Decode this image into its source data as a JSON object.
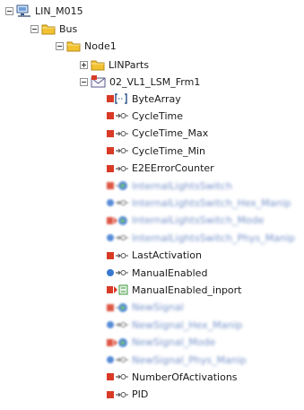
{
  "tree": {
    "root": {
      "label": "LIN_M015",
      "icon": "network-computer-icon"
    },
    "bus": {
      "label": "Bus",
      "icon": "folder-icon"
    },
    "node": {
      "label": "Node1",
      "icon": "folder-icon"
    },
    "linparts": {
      "label": "LINParts",
      "icon": "folder-icon"
    },
    "frame": {
      "label": "02_VL1_LSM_Frm1",
      "icon": "frame-envelope-icon"
    },
    "signals": [
      {
        "label": "ByteArray",
        "icon": "byte-array-icon",
        "blurred": false
      },
      {
        "label": "CycleTime",
        "icon": "output-signal-icon",
        "blurred": false
      },
      {
        "label": "CycleTime_Max",
        "icon": "output-signal-icon",
        "blurred": false
      },
      {
        "label": "CycleTime_Min",
        "icon": "output-signal-icon",
        "blurred": false
      },
      {
        "label": "E2EErrorCounter",
        "icon": "output-signal-icon",
        "blurred": false
      },
      {
        "label": "InternalLightsSwitch",
        "icon": "signal-value-icon",
        "blurred": true
      },
      {
        "label": "InternalLightsSwitch_Hex_Manip",
        "icon": "manip-signal-icon",
        "blurred": true
      },
      {
        "label": "InternalLightsSwitch_Mode",
        "icon": "input-mode-icon",
        "blurred": true
      },
      {
        "label": "InternalLightsSwitch_Phys_Manip",
        "icon": "manip-signal-icon",
        "blurred": true
      },
      {
        "label": "LastActivation",
        "icon": "output-signal-icon",
        "blurred": false
      },
      {
        "label": "ManualEnabled",
        "icon": "manip-signal-icon",
        "blurred": false
      },
      {
        "label": "ManualEnabled_inport",
        "icon": "input-port-icon",
        "blurred": false
      },
      {
        "label": "NewSignal",
        "icon": "signal-value-icon",
        "blurred": true
      },
      {
        "label": "NewSignal_Hex_Manip",
        "icon": "manip-signal-icon",
        "blurred": true
      },
      {
        "label": "NewSignal_Mode",
        "icon": "input-mode-icon",
        "blurred": true
      },
      {
        "label": "NewSignal_Phys_Manip",
        "icon": "manip-signal-icon",
        "blurred": true
      },
      {
        "label": "NumberOfActivations",
        "icon": "output-signal-icon",
        "blurred": false
      },
      {
        "label": "PID",
        "icon": "output-signal-icon",
        "blurred": false
      }
    ]
  },
  "colors": {
    "folder": "#f2c230",
    "red": "#d83a26",
    "blue": "#3a78d0",
    "green": "#3c9a3c"
  }
}
